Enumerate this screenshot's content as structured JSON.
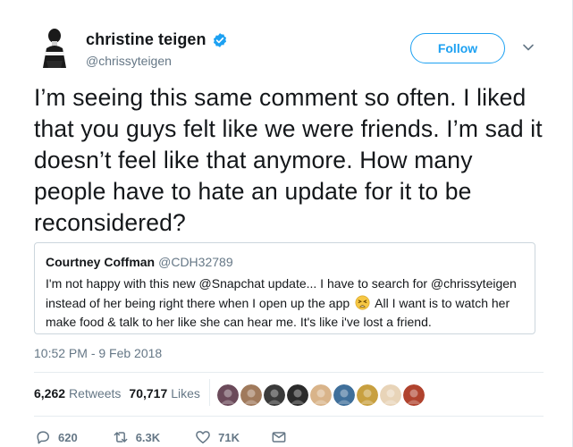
{
  "author": {
    "display_name": "christine teigen",
    "handle": "@chrissyteigen",
    "verified": true
  },
  "header": {
    "follow_label": "Follow"
  },
  "tweet": {
    "text": "I’m seeing this same comment so often. I liked that you guys felt like we were friends. I’m sad it doesn’t feel like that anymore. How many people have to hate an update for it to be reconsidered?"
  },
  "quote": {
    "author_name": "Courtney Coffman",
    "author_handle": "@CDH32789",
    "text_before_emoji": "I'm not happy with this new @Snapchat update... I have to search for @chrissyteigen instead of her being right there when I open up the app",
    "emoji": "tired-face",
    "text_after_emoji": "All I want is to watch her make food & talk to her like she can hear me. It's like i've lost a friend."
  },
  "meta": {
    "timestamp": "10:52 PM - 9 Feb 2018"
  },
  "stats": {
    "retweets_count": "6,262",
    "retweets_label": "Retweets",
    "likes_count": "70,717",
    "likes_label": "Likes"
  },
  "likers": [
    {
      "color": "#6b4a5a"
    },
    {
      "color": "#a07a5c"
    },
    {
      "color": "#3a3a3a"
    },
    {
      "color": "#2b2b2b"
    },
    {
      "color": "#d9b48a"
    },
    {
      "color": "#3f6f9a"
    },
    {
      "color": "#c8a040"
    },
    {
      "color": "#e8d4b8"
    },
    {
      "color": "#b0432e"
    }
  ],
  "actions": {
    "reply_count": "620",
    "retweet_count": "6.3K",
    "like_count": "71K"
  },
  "colors": {
    "accent": "#1da1f2",
    "secondary_text": "#657786",
    "border": "#ccd6dd"
  }
}
